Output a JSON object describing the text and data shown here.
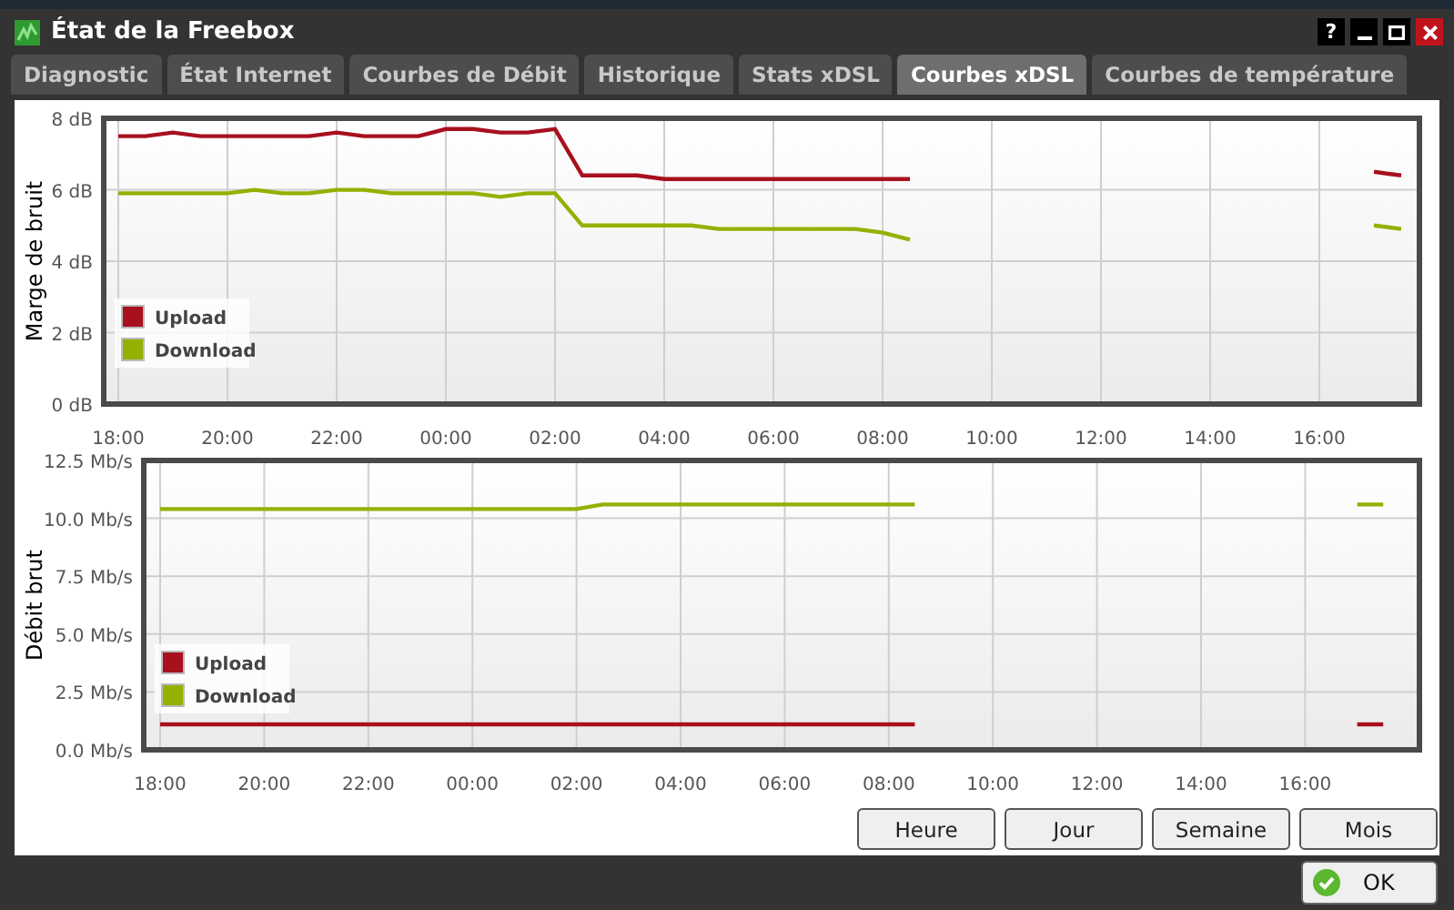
{
  "window": {
    "title": "État de la Freebox",
    "controls": [
      "?"
    ]
  },
  "tabs": [
    {
      "label": "Diagnostic",
      "selected": false
    },
    {
      "label": "État Internet",
      "selected": false
    },
    {
      "label": "Courbes de Débit",
      "selected": false
    },
    {
      "label": "Historique",
      "selected": false
    },
    {
      "label": "Stats xDSL",
      "selected": false
    },
    {
      "label": "Courbes xDSL",
      "selected": true
    },
    {
      "label": "Courbes de température",
      "selected": false
    }
  ],
  "charts": [
    {
      "chart_data": {
        "type": "line",
        "ylabel": "Marge de bruit",
        "categories": [
          "18:00",
          null,
          null,
          null,
          "20:00",
          null,
          null,
          null,
          "22:00",
          null,
          null,
          null,
          "00:00",
          null,
          null,
          null,
          "02:00",
          null,
          null,
          null,
          "04:00",
          null,
          null,
          null,
          "06:00",
          null,
          null,
          null,
          "08:00",
          null,
          null,
          null,
          "10:00",
          null,
          null,
          null,
          "12:00",
          null,
          null,
          null,
          "14:00",
          null,
          null,
          null,
          "16:00",
          null,
          null,
          null
        ],
        "series": [
          {
            "name": "Upload",
            "color": "#a8101e",
            "values": [
              7.5,
              7.5,
              7.6,
              7.5,
              7.5,
              7.5,
              7.5,
              7.5,
              7.6,
              7.5,
              7.5,
              7.5,
              7.7,
              7.7,
              7.6,
              7.6,
              7.7,
              6.4,
              6.4,
              6.4,
              6.3,
              6.3,
              6.3,
              6.3,
              6.3,
              6.3,
              6.3,
              6.3,
              6.3,
              6.3,
              null,
              null,
              null,
              null,
              null,
              null,
              null,
              null,
              null,
              null,
              null,
              null,
              null,
              null,
              null,
              null,
              6.5,
              6.4
            ]
          },
          {
            "name": "Download",
            "color": "#94b000",
            "values": [
              5.9,
              5.9,
              5.9,
              5.9,
              5.9,
              6.0,
              5.9,
              5.9,
              6.0,
              6.0,
              5.9,
              5.9,
              5.9,
              5.9,
              5.8,
              5.9,
              5.9,
              5.0,
              5.0,
              5.0,
              5.0,
              5.0,
              4.9,
              4.9,
              4.9,
              4.9,
              4.9,
              4.9,
              4.8,
              4.6,
              null,
              null,
              null,
              null,
              null,
              null,
              null,
              null,
              null,
              null,
              null,
              null,
              null,
              null,
              null,
              null,
              5.0,
              4.9
            ]
          }
        ],
        "ylim": [
          0,
          8
        ],
        "grid": true,
        "legend": true,
        "yticks": [
          {
            "value": 0,
            "label": "0 dB"
          },
          {
            "value": 2,
            "label": "2 dB"
          },
          {
            "value": 4,
            "label": "4 dB"
          },
          {
            "value": 6,
            "label": "6 dB"
          },
          {
            "value": 8,
            "label": "8 dB"
          }
        ]
      }
    },
    {
      "chart_data": {
        "type": "line",
        "ylabel": "Débit brut",
        "categories": [
          "18:00",
          null,
          null,
          null,
          "20:00",
          null,
          null,
          null,
          "22:00",
          null,
          null,
          null,
          "00:00",
          null,
          null,
          null,
          "02:00",
          null,
          null,
          null,
          "04:00",
          null,
          null,
          null,
          "06:00",
          null,
          null,
          null,
          "08:00",
          null,
          null,
          null,
          "10:00",
          null,
          null,
          null,
          "12:00",
          null,
          null,
          null,
          "14:00",
          null,
          null,
          null,
          "16:00",
          null,
          null,
          null
        ],
        "series": [
          {
            "name": "Upload",
            "color": "#a8101e",
            "values": [
              1.1,
              1.1,
              1.1,
              1.1,
              1.1,
              1.1,
              1.1,
              1.1,
              1.1,
              1.1,
              1.1,
              1.1,
              1.1,
              1.1,
              1.1,
              1.1,
              1.1,
              1.1,
              1.1,
              1.1,
              1.1,
              1.1,
              1.1,
              1.1,
              1.1,
              1.1,
              1.1,
              1.1,
              1.1,
              1.1,
              null,
              null,
              null,
              null,
              null,
              null,
              null,
              null,
              null,
              null,
              null,
              null,
              null,
              null,
              null,
              null,
              1.1,
              1.1
            ]
          },
          {
            "name": "Download",
            "color": "#94b000",
            "values": [
              10.4,
              10.4,
              10.4,
              10.4,
              10.4,
              10.4,
              10.4,
              10.4,
              10.4,
              10.4,
              10.4,
              10.4,
              10.4,
              10.4,
              10.4,
              10.4,
              10.4,
              10.6,
              10.6,
              10.6,
              10.6,
              10.6,
              10.6,
              10.6,
              10.6,
              10.6,
              10.6,
              10.6,
              10.6,
              10.6,
              null,
              null,
              null,
              null,
              null,
              null,
              null,
              null,
              null,
              null,
              null,
              null,
              null,
              null,
              null,
              null,
              10.6,
              10.6
            ]
          }
        ],
        "ylim": [
          0,
          12.5
        ],
        "grid": true,
        "legend": true,
        "yticks": [
          {
            "value": 0,
            "label": "0.0 Mb/s"
          },
          {
            "value": 2.5,
            "label": "2.5 Mb/s"
          },
          {
            "value": 5,
            "label": "5.0 Mb/s"
          },
          {
            "value": 7.5,
            "label": "7.5 Mb/s"
          },
          {
            "value": 10,
            "label": "10.0 Mb/s"
          },
          {
            "value": 12.5,
            "label": "12.5 Mb/s"
          }
        ]
      }
    }
  ],
  "range_buttons": [
    "Heure",
    "Jour",
    "Semaine",
    "Mois"
  ],
  "ok_button": "OK"
}
